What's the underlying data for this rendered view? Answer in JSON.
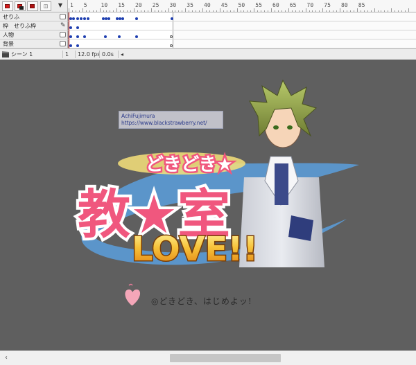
{
  "timeline": {
    "ruler_labels": [
      "1",
      "5",
      "10",
      "15",
      "20",
      "25",
      "30",
      "35",
      "40",
      "45",
      "50",
      "55",
      "60",
      "65",
      "70",
      "75",
      "80",
      "85"
    ],
    "layers": [
      {
        "name": "せりふ",
        "icon": "lock-icon"
      },
      {
        "name": "枠　せりふ枠",
        "icon": "pencil-icon"
      },
      {
        "name": "人物",
        "icon": "lock-icon"
      },
      {
        "name": "背景",
        "icon": "lock-icon"
      }
    ],
    "status": {
      "scene": "シーン 1",
      "frame": "1",
      "fps": "12.0 fps",
      "time": "0.0s"
    }
  },
  "stage": {
    "credit_name": "AchiFujimura",
    "credit_url": "https://www.blackstrawberry.net/",
    "logo_top": "どきどき★",
    "logo_main": "教★室",
    "logo_love": "LOVE!!",
    "tagline": "◎どきどき、はじめよッ!",
    "colors": {
      "pink": "#f0577e",
      "gold": "#f4a21a",
      "blue": "#5b9bd6",
      "stage_bg": "#5f5f5f"
    }
  }
}
